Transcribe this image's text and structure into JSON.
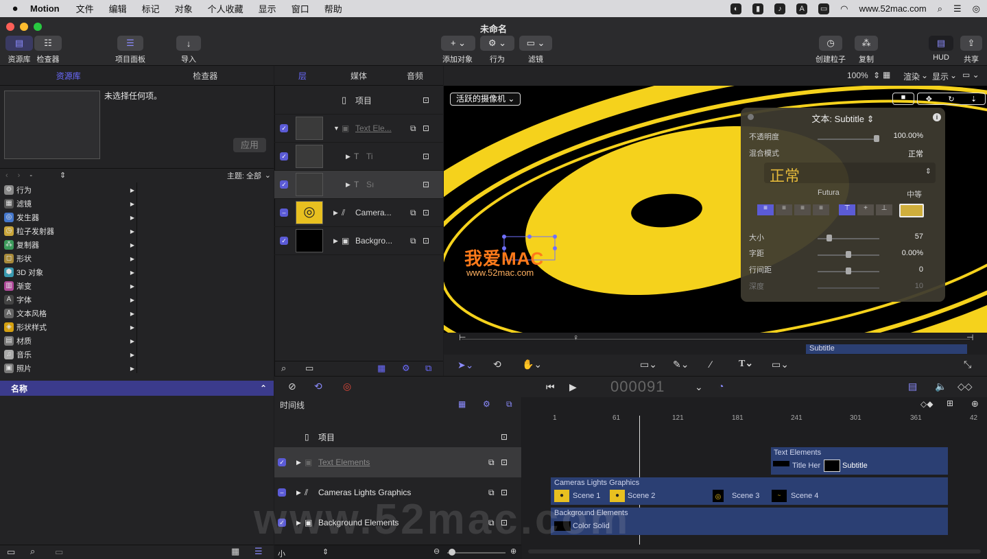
{
  "menubar": {
    "app": "Motion",
    "items": [
      "文件",
      "编辑",
      "标记",
      "对象",
      "个人收藏",
      "显示",
      "窗口",
      "帮助"
    ],
    "url": "www.52mac.com"
  },
  "window": {
    "title": "未命名"
  },
  "toolbar": {
    "library": "资源库",
    "inspector": "检查器",
    "project_panel": "项目面板",
    "import": "导入",
    "add_object": "添加对象",
    "behaviors": "行为",
    "filters": "滤镜",
    "create_particles": "创建粒子",
    "replicate": "复制",
    "hud": "HUD",
    "share": "共享",
    "zoom": "100%",
    "render": "渲染",
    "view": "显示"
  },
  "left": {
    "tabs": [
      "资源库",
      "检查器"
    ],
    "no_selection": "未选择任何项。",
    "apply": "应用",
    "path": "-",
    "theme": "主题: 全部",
    "categories": [
      {
        "label": "行为",
        "icon": "⚙",
        "color": "#888"
      },
      {
        "label": "滤镜",
        "icon": "▦",
        "color": "#555"
      },
      {
        "label": "发生器",
        "icon": "◎",
        "color": "#4477cc"
      },
      {
        "label": "粒子发射器",
        "icon": "◷",
        "color": "#c9a53a"
      },
      {
        "label": "复制器",
        "icon": "⁂",
        "color": "#3a9a5a"
      },
      {
        "label": "形状",
        "icon": "◻",
        "color": "#a88a3a"
      },
      {
        "label": "3D 对象",
        "icon": "⬢",
        "color": "#3a9ab0"
      },
      {
        "label": "渐变",
        "icon": "▥",
        "color": "#b04a9a"
      },
      {
        "label": "字体",
        "icon": "A",
        "color": "#444"
      },
      {
        "label": "文本风格",
        "icon": "A",
        "color": "#666"
      },
      {
        "label": "形状样式",
        "icon": "◈",
        "color": "#d4a010"
      },
      {
        "label": "材质",
        "icon": "▤",
        "color": "#777"
      },
      {
        "label": "音乐",
        "icon": "♫",
        "color": "#aaa"
      },
      {
        "label": "照片",
        "icon": "▣",
        "color": "#777"
      }
    ],
    "name_header": "名称"
  },
  "layers": {
    "tabs": [
      "层",
      "媒体",
      "音频"
    ],
    "project": "项目",
    "rows": [
      "Text Ele...",
      "Ti",
      "Sı",
      "Camera...",
      "Backgro..."
    ]
  },
  "canvas": {
    "camera": "活跃的摄像机",
    "subtitle_bar": "Subtitle",
    "watermark": "我爱MAC",
    "watermark_url": "www.52mac.com"
  },
  "hud": {
    "title": "文本:",
    "title_value": "Subtitle",
    "opacity_label": "不透明度",
    "opacity_value": "100.00%",
    "blend_label": "混合模式",
    "blend_value": "正常",
    "style_value": "正常",
    "font": "Futura",
    "weight": "中等",
    "size_label": "大小",
    "size_value": "57",
    "tracking_label": "字距",
    "tracking_value": "0.00%",
    "line_label": "行间距",
    "line_value": "0",
    "depth_label": "深度",
    "depth_value": "10"
  },
  "transport": {
    "timecode": "000091"
  },
  "timeline": {
    "title": "时间线",
    "project": "项目",
    "layers": [
      "Text Elements",
      "Cameras Lights Graphics",
      "Background Elements"
    ],
    "ruler": [
      "1",
      "61",
      "121",
      "181",
      "241",
      "301",
      "361",
      "42"
    ],
    "group_text": "Text Elements",
    "title_hero": "Title Her",
    "subtitle": "Subtitle",
    "group_cameras": "Cameras Lights Graphics",
    "scenes": [
      "Scene 1",
      "Scene 2",
      "Scene 3",
      "Scene 4"
    ],
    "group_bg": "Background Elements",
    "color_solid": "Color Solid",
    "size": "小",
    "watermark": "www.52mac.com"
  }
}
